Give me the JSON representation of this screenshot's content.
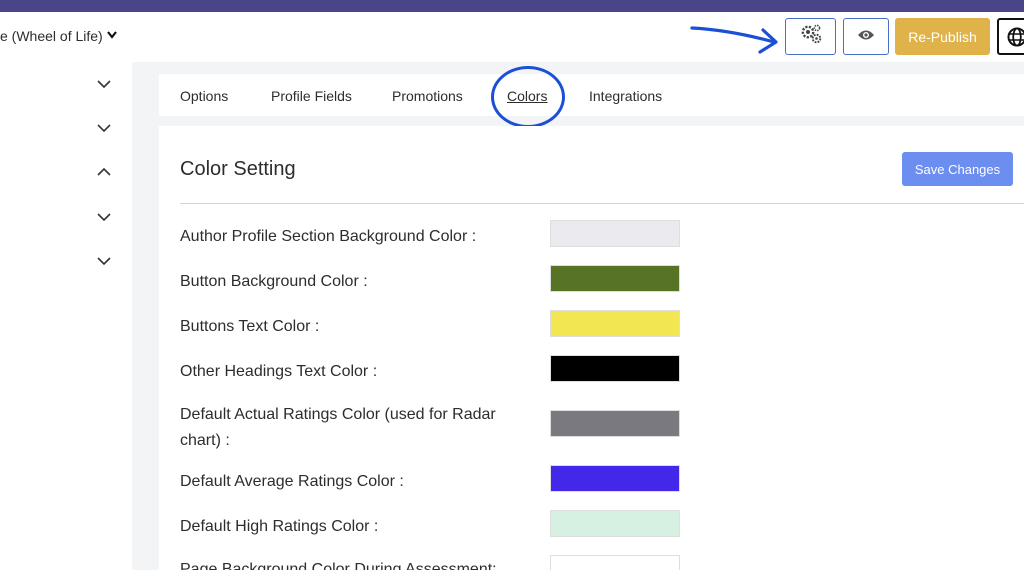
{
  "header": {
    "assessment_name": "e (Wheel of Life)",
    "republish_label": "Re-Publish",
    "icons": [
      "gears-icon",
      "eye-icon",
      "globe-icon"
    ]
  },
  "sidebar": {
    "chevrons": [
      "chevron-down",
      "chevron-down",
      "chevron-up",
      "chevron-down",
      "chevron-down"
    ]
  },
  "tabs": [
    {
      "label": "Options",
      "active": false
    },
    {
      "label": "Profile Fields",
      "active": false
    },
    {
      "label": "Promotions",
      "active": false
    },
    {
      "label": "Colors",
      "active": true
    },
    {
      "label": "Integrations",
      "active": false
    }
  ],
  "card": {
    "title": "Color Setting",
    "save_label": "Save Changes"
  },
  "color_rows": [
    {
      "label": "Author Profile Section Background Color :",
      "color": "#ebebef"
    },
    {
      "label": "Button Background Color :",
      "color": "#567326"
    },
    {
      "label": "Buttons Text Color :",
      "color": "#f2e752"
    },
    {
      "label": "Other Headings Text Color :",
      "color": "#000000"
    },
    {
      "label": "Default Actual Ratings Color (used for Radar chart) :",
      "color": "#7a797f"
    },
    {
      "label": "Default Average Ratings Color :",
      "color": "#4428ea"
    },
    {
      "label": "Default High Ratings Color :",
      "color": "#d6f1e1"
    },
    {
      "label": "Page Background Color During Assessment:",
      "color": "#ffffff"
    }
  ],
  "colors": {
    "top_bar": "#4a4589",
    "republish": "#e0b24a",
    "save": "#6b8ef0",
    "annotation": "#1a4fd6"
  }
}
